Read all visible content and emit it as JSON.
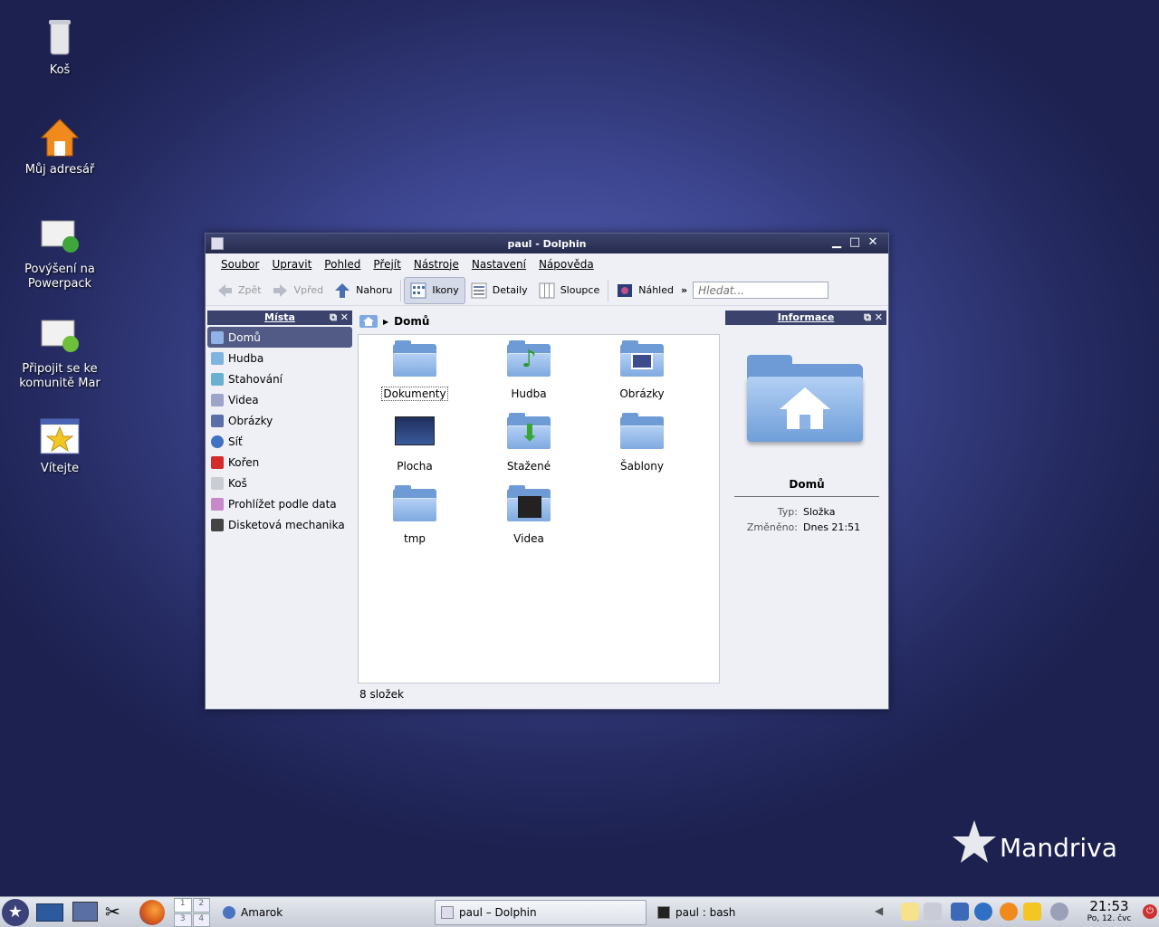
{
  "desktop": {
    "icons": [
      {
        "label": "Koš"
      },
      {
        "label": "Můj adresář"
      },
      {
        "label": "Povýšení na Powerpack"
      },
      {
        "label": "Připojit se ke komunitě Mar"
      },
      {
        "label": "Vítejte"
      }
    ],
    "brand": "Mandriva"
  },
  "window": {
    "title": "paul - Dolphin",
    "menu": [
      "Soubor",
      "Upravit",
      "Pohled",
      "Přejít",
      "Nástroje",
      "Nastavení",
      "Nápověda"
    ],
    "toolbar": {
      "back": "Zpět",
      "forward": "Vpřed",
      "up": "Nahoru",
      "icons": "Ikony",
      "details": "Detaily",
      "columns": "Sloupce",
      "preview": "Náhled",
      "more": "»",
      "search_placeholder": "Hledat..."
    },
    "places": {
      "title": "Místa",
      "items": [
        {
          "label": "Domů"
        },
        {
          "label": "Hudba"
        },
        {
          "label": "Stahování"
        },
        {
          "label": "Videa"
        },
        {
          "label": "Obrázky"
        },
        {
          "label": "Síť"
        },
        {
          "label": "Kořen"
        },
        {
          "label": "Koš"
        },
        {
          "label": "Prohlížet podle data"
        },
        {
          "label": "Disketová mechanika"
        }
      ]
    },
    "breadcrumb": "Domů",
    "files": [
      {
        "name": "Dokumenty"
      },
      {
        "name": "Hudba"
      },
      {
        "name": "Obrázky"
      },
      {
        "name": "Plocha"
      },
      {
        "name": "Stažené"
      },
      {
        "name": "Šablony"
      },
      {
        "name": "tmp"
      },
      {
        "name": "Videa"
      }
    ],
    "status": "8 složek",
    "info": {
      "title": "Informace",
      "name": "Domů",
      "type_key": "Typ:",
      "type_val": "Složka",
      "modified_key": "Změněno:",
      "modified_val": "Dnes 21:51"
    }
  },
  "taskbar": {
    "tasks": [
      "Amarok",
      "paul – Dolphin",
      "paul : bash"
    ],
    "pager": [
      "1",
      "2",
      "3",
      "4"
    ],
    "clock_time": "21:53",
    "clock_date": "Po, 12. čvc"
  }
}
